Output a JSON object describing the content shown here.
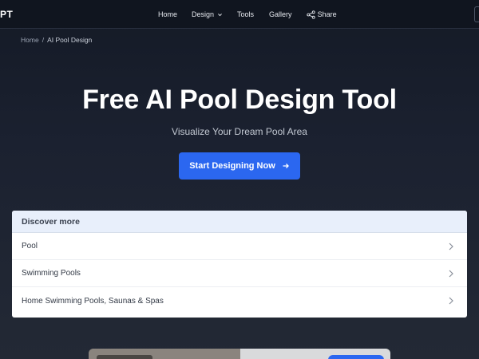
{
  "nav": {
    "brand": "PT",
    "items": [
      {
        "label": "Home"
      },
      {
        "label": "Design"
      },
      {
        "label": "Tools"
      },
      {
        "label": "Gallery"
      },
      {
        "label": "Share"
      }
    ]
  },
  "breadcrumb": {
    "home": "Home",
    "separator": "/",
    "current": "AI Pool Design"
  },
  "hero": {
    "title": "Free AI Pool Design Tool",
    "subtitle": "Visualize Your Dream Pool Area",
    "cta_label": "Start Designing Now"
  },
  "discover": {
    "heading": "Discover more",
    "items": [
      {
        "label": "Pool"
      },
      {
        "label": "Swimming Pools"
      },
      {
        "label": "Home Swimming Pools, Saunas & Spas"
      }
    ]
  },
  "colors": {
    "accent": "#2b67f0",
    "nav_bg": "#10151f",
    "card_header": "#e8effb"
  }
}
